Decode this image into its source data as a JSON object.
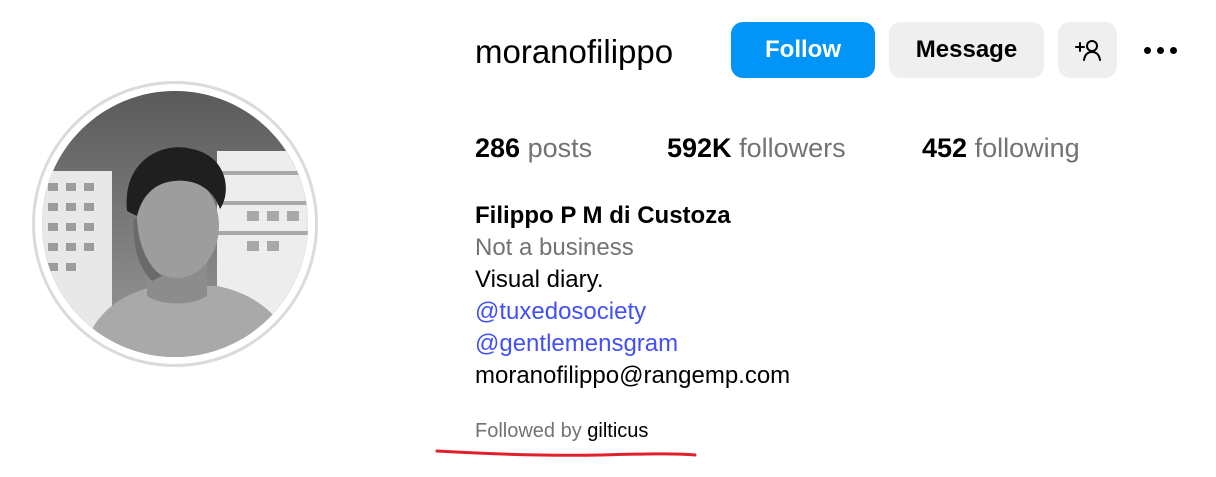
{
  "profile": {
    "username": "moranofilippo",
    "full_name": "Filippo P M di Custoza",
    "category": "Not a business",
    "bio": "Visual diary.",
    "mentions": [
      "@tuxedosociety",
      "@gentlemensgram"
    ],
    "email": "moranofilippo@rangemp.com",
    "followed_by_label": "Followed by",
    "followed_by_user": "gilticus"
  },
  "actions": {
    "follow_label": "Follow",
    "message_label": "Message",
    "add_user_icon": "person-plus-icon",
    "more_icon": "more-horizontal-icon"
  },
  "stats": {
    "posts_count": "286",
    "posts_label": "posts",
    "followers_count": "592K",
    "followers_label": "followers",
    "following_count": "452",
    "following_label": "following"
  },
  "colors": {
    "follow_button": "#0095f6",
    "secondary_button": "#efefef",
    "link": "#4150f7",
    "muted_text": "#737373",
    "annotation_underline": "#e0202a"
  }
}
